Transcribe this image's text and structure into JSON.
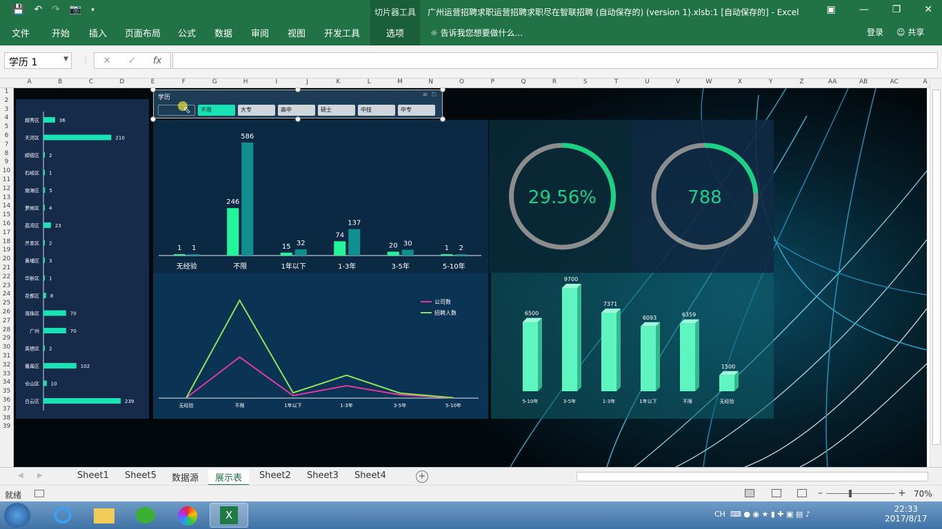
{
  "app": {
    "context_tab_group": "切片器工具",
    "window_title": "广州运营招聘求职运营招聘求职尽在智联招聘 (自动保存的) (version 1).xlsb:1 [自动保存的] - Excel",
    "ribbon_tabs": [
      "文件",
      "开始",
      "插入",
      "页面布局",
      "公式",
      "数据",
      "审阅",
      "视图",
      "开发工具",
      "选项"
    ],
    "tell_me": "告诉我您想要做什么...",
    "login": "登录",
    "share": "共享"
  },
  "formula_bar": {
    "name_box": "学历 1",
    "fx": "fx",
    "formula": ""
  },
  "columns": [
    "A",
    "B",
    "C",
    "D",
    "E",
    "F",
    "G",
    "H",
    "I",
    "J",
    "K",
    "L",
    "M",
    "N",
    "O",
    "P",
    "Q",
    "R",
    "S",
    "T",
    "U",
    "V",
    "W",
    "X",
    "Y",
    "Z",
    "AA",
    "AB",
    "AC",
    "A"
  ],
  "rows": [
    "1",
    "2",
    "3",
    "4",
    "5",
    "6",
    "7",
    "8",
    "9",
    "10",
    "11",
    "12",
    "13",
    "14",
    "15",
    "16",
    "17",
    "18",
    "19",
    "20",
    "21",
    "22",
    "23",
    "24",
    "25",
    "26",
    "27",
    "28",
    "29",
    "30",
    "31",
    "32",
    "33",
    "34",
    "35",
    "36",
    "37",
    "38",
    "39"
  ],
  "slicer": {
    "title": "学历",
    "items": [
      {
        "label": "",
        "state": "blank"
      },
      {
        "label": "不限",
        "state": "selected"
      },
      {
        "label": "大专",
        "state": "normal"
      },
      {
        "label": "高中",
        "state": "normal"
      },
      {
        "label": "硕士",
        "state": "normal"
      },
      {
        "label": "中技",
        "state": "normal"
      },
      {
        "label": "中专",
        "state": "normal"
      }
    ]
  },
  "chart_data": [
    {
      "type": "bar",
      "orientation": "horizontal",
      "categories": [
        "越秀区",
        "天河区",
        "顺德区",
        "石岐区",
        "南海区",
        "萝岗区",
        "荔湾区",
        "开发区",
        "黄埔区",
        "华新区",
        "花都区",
        "海珠区",
        "广州",
        "英德区",
        "番禺区",
        "仓山区",
        "白云区"
      ],
      "values": [
        36,
        210,
        2,
        1,
        5,
        4,
        23,
        2,
        3,
        1,
        8,
        70,
        70,
        2,
        102,
        10,
        239
      ],
      "color": "#19e3b4"
    },
    {
      "type": "bar",
      "categories": [
        "无经验",
        "不限",
        "1年以下",
        "1-3年",
        "3-5年",
        "5-10年"
      ],
      "series": [
        {
          "values": [
            1,
            246,
            15,
            74,
            20,
            1
          ],
          "color": "#22f59a"
        },
        {
          "values": [
            1,
            586,
            32,
            137,
            30,
            2
          ],
          "color": "#0f8f90"
        }
      ]
    },
    {
      "type": "line",
      "categories": [
        "无经验",
        "不限",
        "1年以下",
        "1-3年",
        "3-5年",
        "5-10年"
      ],
      "series": [
        {
          "name": "公司数",
          "values": [
            1,
            246,
            15,
            74,
            20,
            1
          ],
          "color": "#e23aa2"
        },
        {
          "name": "招聘人数",
          "values": [
            1,
            586,
            32,
            137,
            30,
            2
          ],
          "color": "#8fe35a"
        }
      ],
      "legend": "top-right"
    },
    {
      "type": "pie",
      "kind": "ring",
      "label": "29.56%",
      "fraction": 0.2956,
      "color": "#1de58f"
    },
    {
      "type": "pie",
      "kind": "ring",
      "label": "788",
      "color": "#1de58f"
    },
    {
      "type": "bar",
      "style": "3d-column",
      "categories": [
        "5-10年",
        "3-5年",
        "1-3年",
        "1年以下",
        "不限",
        "无经验"
      ],
      "values": [
        6500,
        9700,
        7371,
        6093,
        6359,
        1500
      ],
      "color": "#5ef5c0"
    }
  ],
  "sheets": [
    "Sheet1",
    "Sheet5",
    "数据源",
    "展示表",
    "Sheet2",
    "Sheet3",
    "Sheet4"
  ],
  "active_sheet": "展示表",
  "status": {
    "ready": "就绪",
    "zoom": "70%"
  },
  "taskbar": {
    "ime": "CH",
    "time": "22:33",
    "date": "2017/8/17"
  },
  "colors": {
    "excel_green": "#217346",
    "accent": "#19e3b4"
  }
}
